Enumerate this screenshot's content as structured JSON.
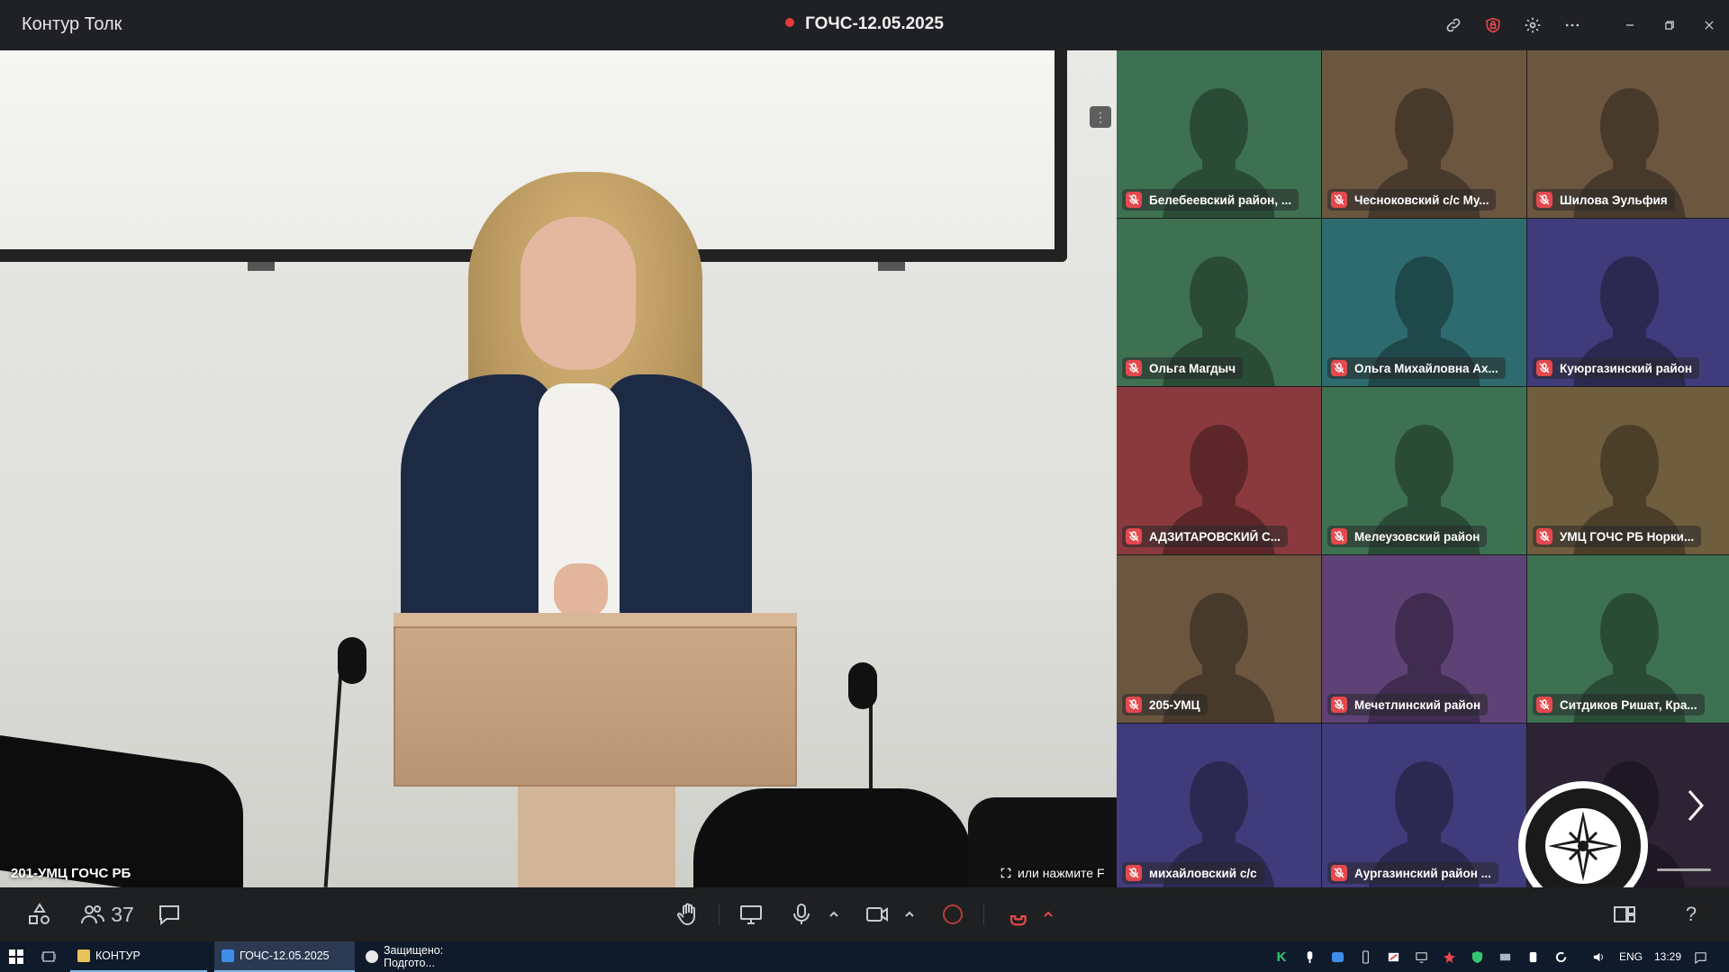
{
  "window": {
    "app_title": "Контур Толк",
    "meeting_title": "ГОЧС-12.05.2025",
    "icons": [
      "link-icon",
      "shield-icon",
      "gear-icon",
      "more-icon",
      "minimize-icon",
      "restore-icon",
      "close-icon"
    ]
  },
  "speaker": {
    "name": "201-УМЦ ГОЧС РБ",
    "fullscreen_hint": "или нажмите F"
  },
  "tiles": [
    {
      "name": "Белебеевский район, ...",
      "color": "#3e7152"
    },
    {
      "name": "Чесноковский с/с Му...",
      "color": "#6b5640"
    },
    {
      "name": "Шилова Эульфия",
      "color": "#6b5640"
    },
    {
      "name": "Ольга Магдыч",
      "color": "#3e7152"
    },
    {
      "name": "Ольга Михайловна Ах...",
      "color": "#2e6b6e"
    },
    {
      "name": "Куюргазинский район",
      "color": "#403b7a"
    },
    {
      "name": "АДЗИТАРОВСКИЙ С...",
      "color": "#8a3a3e"
    },
    {
      "name": "Мелеузовский район",
      "color": "#3e7152"
    },
    {
      "name": "УМЦ ГОЧС РБ Норки...",
      "color": "#6f5e3e"
    },
    {
      "name": "205-УМЦ",
      "color": "#6b5640"
    },
    {
      "name": "Мечетлинский район",
      "color": "#5e4276"
    },
    {
      "name": "Ситдиков Ришат, Кра...",
      "color": "#3e7152"
    },
    {
      "name": "михайловский с/с",
      "color": "#403b7a"
    },
    {
      "name": "Аургазинский район ...",
      "color": "#403b7a"
    },
    {
      "name": "",
      "color": "#2d2335"
    }
  ],
  "controls": {
    "participants_count": "37"
  },
  "taskbar": {
    "items": [
      {
        "label": "КОНТУР",
        "icon_color": "#e8c35a"
      },
      {
        "label": "ГОЧС-12.05.2025",
        "icon_color": "#3d8ee8"
      },
      {
        "label": "Защищено: Подгото...",
        "icon_color": "#e8e8e8"
      }
    ],
    "language": "ENG",
    "time": "13:29"
  }
}
